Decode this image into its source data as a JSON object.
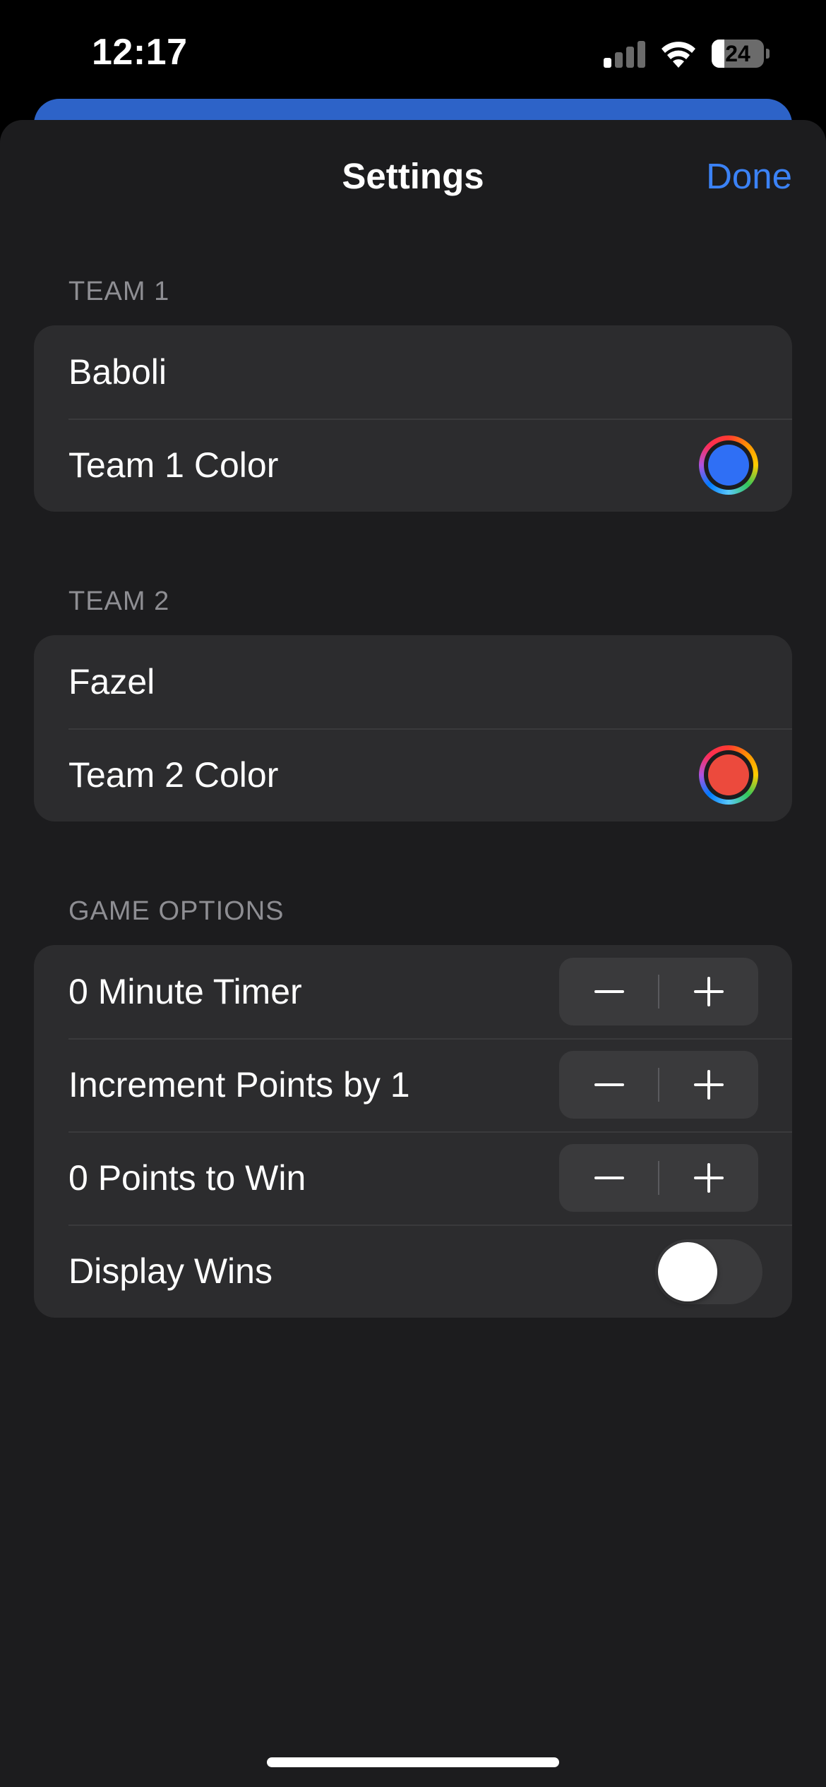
{
  "status_bar": {
    "time": "12:17",
    "battery_level": "24",
    "battery_fraction": 0.24
  },
  "nav": {
    "title": "Settings",
    "done_label": "Done"
  },
  "team1": {
    "header": "TEAM 1",
    "name": "Baboli",
    "color_label": "Team 1 Color",
    "color": "#2f6ff5"
  },
  "team2": {
    "header": "TEAM 2",
    "name": "Fazel",
    "color_label": "Team 2 Color",
    "color": "#ec4a3d"
  },
  "game_options": {
    "header": "GAME OPTIONS",
    "timer_label": "0 Minute Timer",
    "increment_label": "Increment Points by 1",
    "points_to_win_label": "0 Points to Win",
    "display_wins_label": "Display Wins",
    "display_wins_on": false
  },
  "icons": {
    "minus": "minus-icon",
    "plus": "plus-icon",
    "signal": "cellular-signal-icon",
    "wifi": "wifi-icon",
    "battery": "battery-icon"
  },
  "colors": {
    "accent": "#3b82f6",
    "sheet_background": "#1c1c1e",
    "group_background": "#2c2c2e",
    "secondary_text": "#8e8e93"
  }
}
